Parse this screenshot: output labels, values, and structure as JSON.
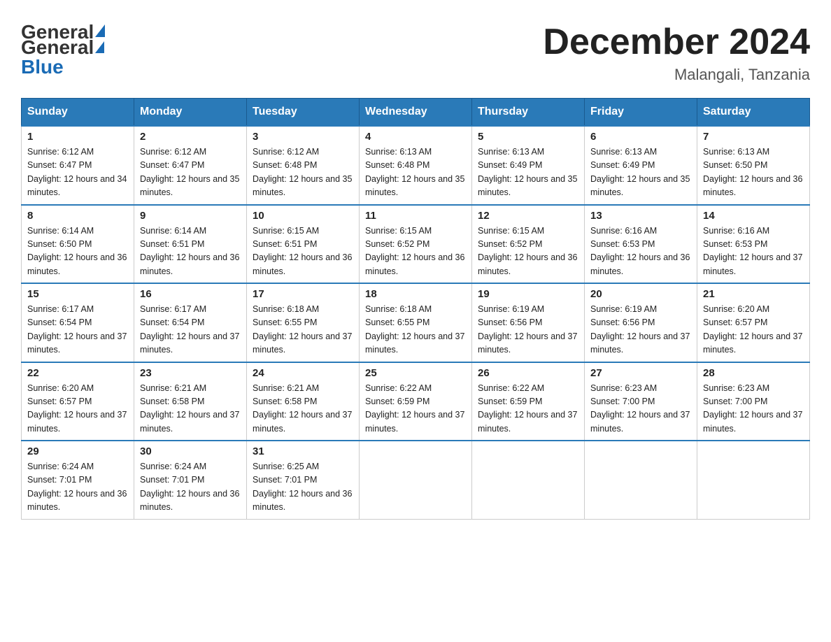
{
  "header": {
    "logo_general": "General",
    "logo_blue": "Blue",
    "month_title": "December 2024",
    "location": "Malangali, Tanzania"
  },
  "weekdays": [
    "Sunday",
    "Monday",
    "Tuesday",
    "Wednesday",
    "Thursday",
    "Friday",
    "Saturday"
  ],
  "weeks": [
    [
      {
        "day": "1",
        "sunrise": "6:12 AM",
        "sunset": "6:47 PM",
        "daylight": "12 hours and 34 minutes."
      },
      {
        "day": "2",
        "sunrise": "6:12 AM",
        "sunset": "6:47 PM",
        "daylight": "12 hours and 35 minutes."
      },
      {
        "day": "3",
        "sunrise": "6:12 AM",
        "sunset": "6:48 PM",
        "daylight": "12 hours and 35 minutes."
      },
      {
        "day": "4",
        "sunrise": "6:13 AM",
        "sunset": "6:48 PM",
        "daylight": "12 hours and 35 minutes."
      },
      {
        "day": "5",
        "sunrise": "6:13 AM",
        "sunset": "6:49 PM",
        "daylight": "12 hours and 35 minutes."
      },
      {
        "day": "6",
        "sunrise": "6:13 AM",
        "sunset": "6:49 PM",
        "daylight": "12 hours and 35 minutes."
      },
      {
        "day": "7",
        "sunrise": "6:13 AM",
        "sunset": "6:50 PM",
        "daylight": "12 hours and 36 minutes."
      }
    ],
    [
      {
        "day": "8",
        "sunrise": "6:14 AM",
        "sunset": "6:50 PM",
        "daylight": "12 hours and 36 minutes."
      },
      {
        "day": "9",
        "sunrise": "6:14 AM",
        "sunset": "6:51 PM",
        "daylight": "12 hours and 36 minutes."
      },
      {
        "day": "10",
        "sunrise": "6:15 AM",
        "sunset": "6:51 PM",
        "daylight": "12 hours and 36 minutes."
      },
      {
        "day": "11",
        "sunrise": "6:15 AM",
        "sunset": "6:52 PM",
        "daylight": "12 hours and 36 minutes."
      },
      {
        "day": "12",
        "sunrise": "6:15 AM",
        "sunset": "6:52 PM",
        "daylight": "12 hours and 36 minutes."
      },
      {
        "day": "13",
        "sunrise": "6:16 AM",
        "sunset": "6:53 PM",
        "daylight": "12 hours and 36 minutes."
      },
      {
        "day": "14",
        "sunrise": "6:16 AM",
        "sunset": "6:53 PM",
        "daylight": "12 hours and 37 minutes."
      }
    ],
    [
      {
        "day": "15",
        "sunrise": "6:17 AM",
        "sunset": "6:54 PM",
        "daylight": "12 hours and 37 minutes."
      },
      {
        "day": "16",
        "sunrise": "6:17 AM",
        "sunset": "6:54 PM",
        "daylight": "12 hours and 37 minutes."
      },
      {
        "day": "17",
        "sunrise": "6:18 AM",
        "sunset": "6:55 PM",
        "daylight": "12 hours and 37 minutes."
      },
      {
        "day": "18",
        "sunrise": "6:18 AM",
        "sunset": "6:55 PM",
        "daylight": "12 hours and 37 minutes."
      },
      {
        "day": "19",
        "sunrise": "6:19 AM",
        "sunset": "6:56 PM",
        "daylight": "12 hours and 37 minutes."
      },
      {
        "day": "20",
        "sunrise": "6:19 AM",
        "sunset": "6:56 PM",
        "daylight": "12 hours and 37 minutes."
      },
      {
        "day": "21",
        "sunrise": "6:20 AM",
        "sunset": "6:57 PM",
        "daylight": "12 hours and 37 minutes."
      }
    ],
    [
      {
        "day": "22",
        "sunrise": "6:20 AM",
        "sunset": "6:57 PM",
        "daylight": "12 hours and 37 minutes."
      },
      {
        "day": "23",
        "sunrise": "6:21 AM",
        "sunset": "6:58 PM",
        "daylight": "12 hours and 37 minutes."
      },
      {
        "day": "24",
        "sunrise": "6:21 AM",
        "sunset": "6:58 PM",
        "daylight": "12 hours and 37 minutes."
      },
      {
        "day": "25",
        "sunrise": "6:22 AM",
        "sunset": "6:59 PM",
        "daylight": "12 hours and 37 minutes."
      },
      {
        "day": "26",
        "sunrise": "6:22 AM",
        "sunset": "6:59 PM",
        "daylight": "12 hours and 37 minutes."
      },
      {
        "day": "27",
        "sunrise": "6:23 AM",
        "sunset": "7:00 PM",
        "daylight": "12 hours and 37 minutes."
      },
      {
        "day": "28",
        "sunrise": "6:23 AM",
        "sunset": "7:00 PM",
        "daylight": "12 hours and 37 minutes."
      }
    ],
    [
      {
        "day": "29",
        "sunrise": "6:24 AM",
        "sunset": "7:01 PM",
        "daylight": "12 hours and 36 minutes."
      },
      {
        "day": "30",
        "sunrise": "6:24 AM",
        "sunset": "7:01 PM",
        "daylight": "12 hours and 36 minutes."
      },
      {
        "day": "31",
        "sunrise": "6:25 AM",
        "sunset": "7:01 PM",
        "daylight": "12 hours and 36 minutes."
      },
      null,
      null,
      null,
      null
    ]
  ]
}
